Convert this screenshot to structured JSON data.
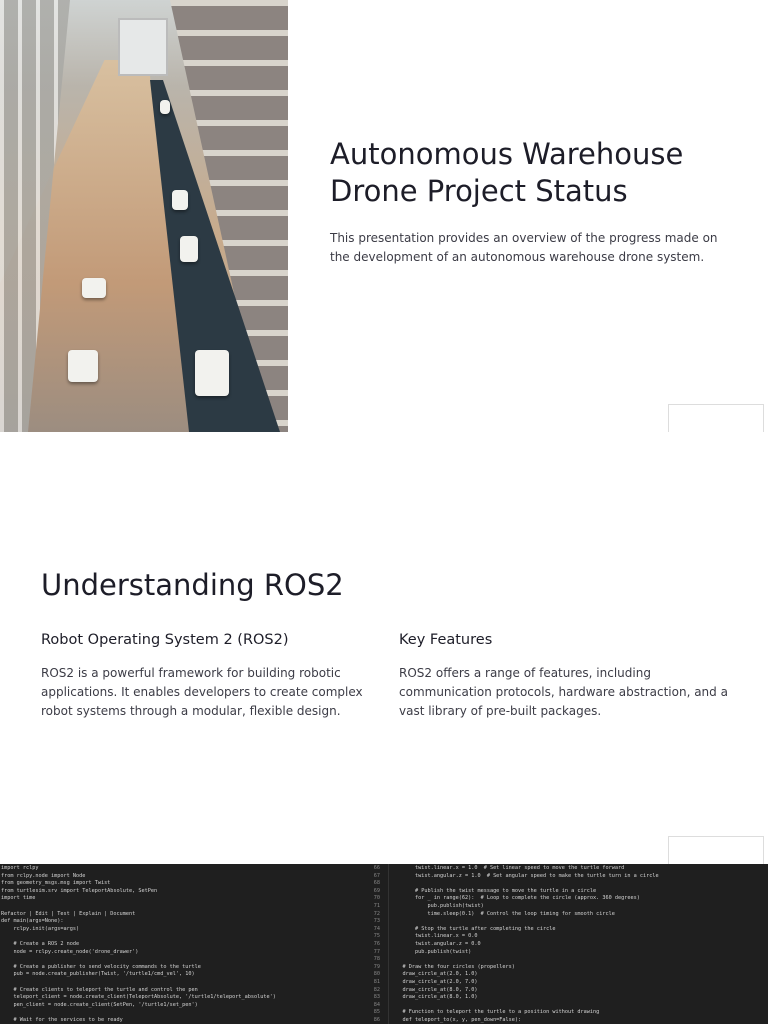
{
  "slide1": {
    "title": "Autonomous Warehouse Drone Project Status",
    "subtitle": "This presentation provides an overview of the progress made on the development of an autonomous warehouse drone system."
  },
  "slide2": {
    "title": "Understanding ROS2",
    "columns": [
      {
        "heading": "Robot Operating System 2 (ROS2)",
        "body": "ROS2 is a powerful framework for building robotic applications. It enables developers to create complex robot systems through a modular, flexible design."
      },
      {
        "heading": "Key Features",
        "body": "ROS2 offers a range of features, including communication protocols, hardware abstraction, and a vast library of pre-built packages."
      }
    ]
  },
  "slide3": {
    "code_left": "import rclpy\nfrom rclpy.node import Node\nfrom geometry_msgs.msg import Twist\nfrom turtlesim.srv import TeleportAbsolute, SetPen\nimport time\n\nRefactor | Edit | Test | Explain | Document\ndef main(args=None):\n    rclpy.init(args=args)\n\n    # Create a ROS 2 node\n    node = rclpy.create_node('drone_drawer')\n\n    # Create a publisher to send velocity commands to the turtle\n    pub = node.create_publisher(Twist, '/turtle1/cmd_vel', 10)\n\n    # Create clients to teleport the turtle and control the pen\n    teleport_client = node.create_client(TeleportAbsolute, '/turtle1/teleport_absolute')\n    pen_client = node.create_client(SetPen, '/turtle1/set_pen')\n\n    # Wait for the services to be ready\n    while not teleport_client.wait_for_service(timeout_sec=1.0):\n        node.get_logger().info('Waiting for teleport service...')\n    while not pen_client.wait_for_service(timeout_sec=1.0):\n        node.get_logger().info('Waiting for set_pen service...')",
    "line_numbers": "66\n67\n68\n69\n70\n71\n72\n73\n74\n75\n76\n77\n78\n79\n80\n81\n82\n83\n84\n85\n86",
    "code_right": "        twist.linear.x = 1.0  # Set linear speed to move the turtle forward\n        twist.angular.z = 1.0  # Set angular speed to make the turtle turn in a circle\n\n        # Publish the twist message to move the turtle in a circle\n        for _ in range(62):  # Loop to complete the circle (approx. 360 degrees)\n            pub.publish(twist)\n            time.sleep(0.1)  # Control the loop timing for smooth circle\n\n        # Stop the turtle after completing the circle\n        twist.linear.x = 0.0\n        twist.angular.z = 0.0\n        pub.publish(twist)\n\n    # Draw the four circles (propellers)\n    draw_circle_at(2.0, 1.0)\n    draw_circle_at(2.0, 7.0)\n    draw_circle_at(8.0, 7.0)\n    draw_circle_at(8.0, 1.0)\n\n    # Function to teleport the turtle to a position without drawing\n    def teleport_to(x, y, pen_down=False):"
  },
  "colors": {
    "code_bg": "#1f1f1f",
    "text": "#1d1d28",
    "body": "#3c3c46"
  }
}
